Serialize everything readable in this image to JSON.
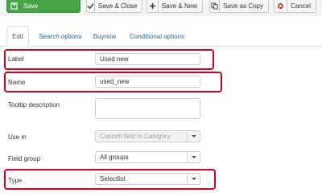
{
  "toolbar": {
    "save_label": "Save",
    "save_close_label": "Save & Close",
    "save_new_label": "Save & New",
    "save_copy_label": "Save as Copy",
    "cancel_label": "Cancel"
  },
  "tabs": [
    {
      "label": "Edit",
      "active": true
    },
    {
      "label": "Search options",
      "active": false
    },
    {
      "label": "Buynow",
      "active": false
    },
    {
      "label": "Conditional options",
      "active": false
    }
  ],
  "form": {
    "label": {
      "label": "Label",
      "value": "Used new"
    },
    "name": {
      "label": "Name",
      "value": "used_new"
    },
    "tooltip": {
      "label": "Tooltip description",
      "value": ""
    },
    "use_in": {
      "label": "Use in",
      "value": "Custom field in Category",
      "disabled": true
    },
    "field_group": {
      "label": "Field group",
      "value": "All groups"
    },
    "type": {
      "label": "Type",
      "value": "Selectlist"
    }
  },
  "colors": {
    "save_green": "#46a546",
    "highlight_red": "#d0021b",
    "tab_link": "#2a6496"
  },
  "icons": {
    "save": "save-icon",
    "save_close": "check-icon",
    "save_new": "plus-icon",
    "save_copy": "copy-icon",
    "cancel": "cancel-icon"
  }
}
